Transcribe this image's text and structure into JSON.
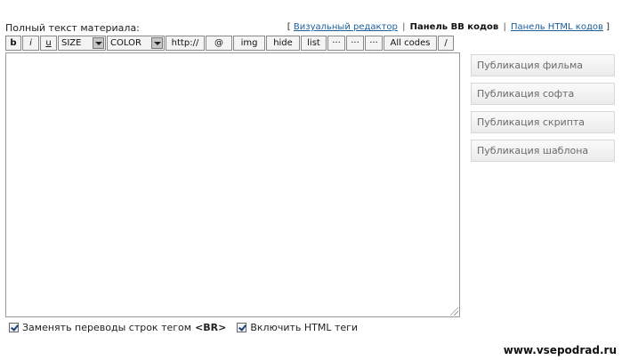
{
  "editor": {
    "field_label": "Полный текст материала:",
    "switch": {
      "bracket_open": "[",
      "visual": "Визуальный редактор",
      "bb_panel": "Панель BB кодов",
      "html_panel": "Панель HTML кодов",
      "bracket_close": "]",
      "separator": "|"
    },
    "toolbar": {
      "bold": "b",
      "italic": "i",
      "underline": "u",
      "size": "SIZE",
      "color": "COLOR",
      "http": "http://",
      "email": "@",
      "img": "img",
      "hide": "hide",
      "list": "list",
      "more1": "···",
      "more2": "···",
      "more3": "···",
      "all_codes": "All codes",
      "close_tag": "/"
    },
    "content": ""
  },
  "side_buttons": [
    "Публикация фильма",
    "Публикация софта",
    "Публикация скрипта",
    "Публикация шаблона"
  ],
  "options": {
    "replace_br_prefix": "Заменять переводы строк тегом",
    "replace_br_tag": "<BR>",
    "replace_br_checked": true,
    "enable_html": "Включить HTML теги",
    "enable_html_checked": true
  },
  "watermark": "www.vsepodrad.ru"
}
